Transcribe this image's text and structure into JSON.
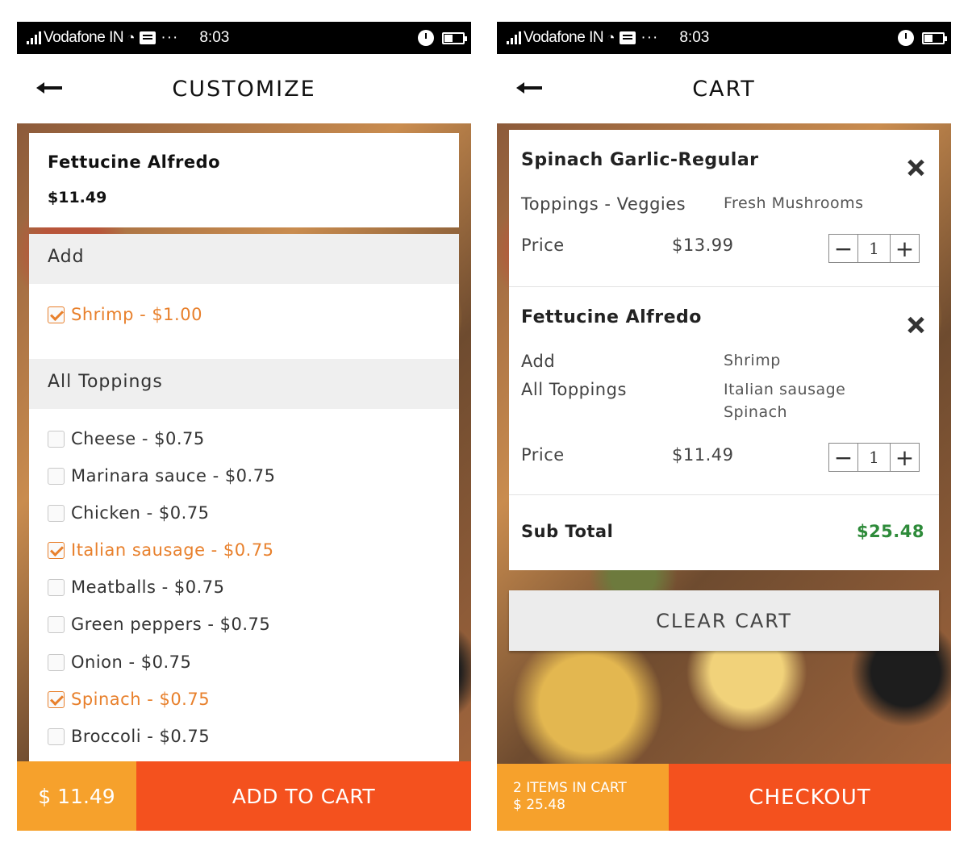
{
  "status_bar": {
    "carrier": "Vodafone IN",
    "dots": "···",
    "time": "8:03"
  },
  "customize": {
    "title": "CUSTOMIZE",
    "item": {
      "name": "Fettucine Alfredo",
      "price": "$11.49"
    },
    "sections": [
      {
        "header": "Add",
        "options": [
          {
            "label": "Shrimp - $1.00",
            "checked": true
          }
        ]
      },
      {
        "header": "All Toppings",
        "options": [
          {
            "label": "Cheese - $0.75",
            "checked": false
          },
          {
            "label": "Marinara sauce - $0.75",
            "checked": false
          },
          {
            "label": "Chicken - $0.75",
            "checked": false
          },
          {
            "label": "Italian sausage - $0.75",
            "checked": true
          },
          {
            "label": "Meatballs - $0.75",
            "checked": false
          },
          {
            "label": "Green peppers - $0.75",
            "checked": false
          },
          {
            "label": "Onion - $0.75",
            "checked": false
          },
          {
            "label": "Spinach - $0.75",
            "checked": true
          },
          {
            "label": "Broccoli - $0.75",
            "checked": false
          }
        ]
      }
    ],
    "bottom": {
      "price": "$ 11.49",
      "action": "ADD TO CART"
    }
  },
  "cart": {
    "title": "CART",
    "items": [
      {
        "name": "Spinach Garlic-Regular",
        "details": [
          {
            "label": "Toppings - Veggies",
            "value": "Fresh Mushrooms"
          }
        ],
        "price_label": "Price",
        "price": "$13.99",
        "quantity": "1"
      },
      {
        "name": "Fettucine Alfredo",
        "details": [
          {
            "label": "Add",
            "value": "Shrimp"
          },
          {
            "label": "All Toppings",
            "value": "Italian sausage",
            "value2": "Spinach"
          }
        ],
        "price_label": "Price",
        "price": "$11.49",
        "quantity": "1"
      }
    ],
    "subtotal_label": "Sub Total",
    "subtotal": "$25.48",
    "clear_label": "CLEAR CART",
    "summary_line1": "2 ITEMS IN CART",
    "summary_line2": "$ 25.48",
    "checkout_label": "CHECKOUT"
  },
  "colors": {
    "accent_orange": "#f4511e",
    "accent_yellow": "#f6a12c",
    "checked_text": "#e8802c",
    "subtotal_green": "#2e8b3a"
  }
}
